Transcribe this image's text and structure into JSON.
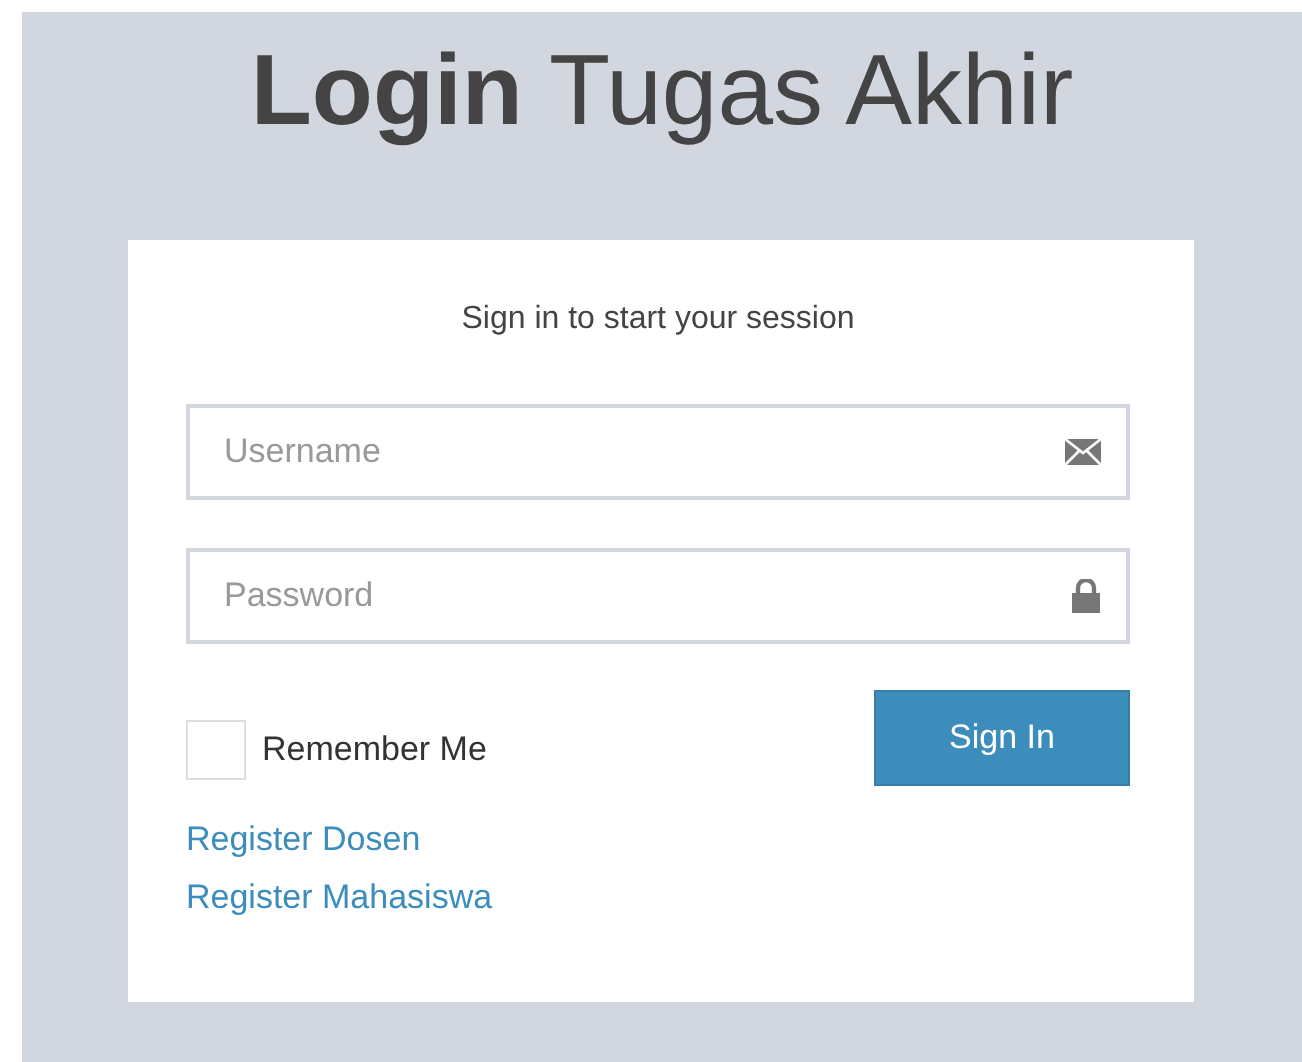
{
  "title": "**Login** Tugas Akhir",
  "login_box": {
    "message": "Sign in to start your session",
    "fields": [
      {
        "placeholder": "Username",
        "kind": "email"
      },
      {
        "placeholder": "Password",
        "kind": "password"
      }
    ],
    "remember_me": {
      "label": "Remember Me",
      "checked": false
    },
    "sign_in_button": "Sign In",
    "links": [
      "Register Dosen",
      "Register Mahasiswa"
    ]
  }
}
